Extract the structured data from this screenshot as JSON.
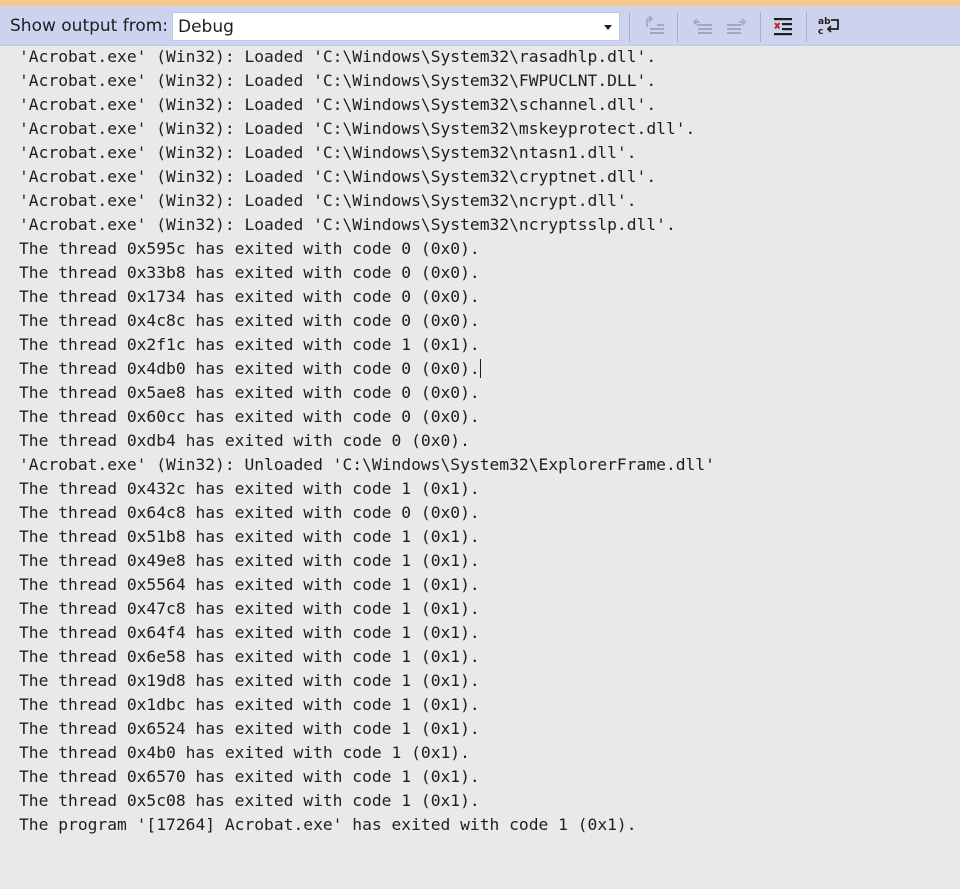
{
  "toolbar": {
    "show_output_label": "Show output from:",
    "source_select": {
      "selected": "Debug"
    },
    "buttons": [
      {
        "name": "find-message-in-code-button",
        "icon": "find-in-code-icon",
        "enabled": false
      },
      {
        "name": "previous-message-button",
        "icon": "go-to-previous-icon",
        "enabled": false
      },
      {
        "name": "next-message-button",
        "icon": "go-to-next-icon",
        "enabled": false
      },
      {
        "name": "clear-all-button",
        "icon": "clear-all-icon",
        "enabled": true
      },
      {
        "name": "toggle-word-wrap-button",
        "icon": "word-wrap-icon",
        "enabled": true
      }
    ]
  },
  "output": {
    "lines": [
      "'Acrobat.exe' (Win32): Loaded 'C:\\Windows\\System32\\rasadhlp.dll'.",
      "'Acrobat.exe' (Win32): Loaded 'C:\\Windows\\System32\\FWPUCLNT.DLL'.",
      "'Acrobat.exe' (Win32): Loaded 'C:\\Windows\\System32\\schannel.dll'.",
      "'Acrobat.exe' (Win32): Loaded 'C:\\Windows\\System32\\mskeyprotect.dll'.",
      "'Acrobat.exe' (Win32): Loaded 'C:\\Windows\\System32\\ntasn1.dll'.",
      "'Acrobat.exe' (Win32): Loaded 'C:\\Windows\\System32\\cryptnet.dll'.",
      "'Acrobat.exe' (Win32): Loaded 'C:\\Windows\\System32\\ncrypt.dll'.",
      "'Acrobat.exe' (Win32): Loaded 'C:\\Windows\\System32\\ncryptsslp.dll'.",
      "The thread 0x595c has exited with code 0 (0x0).",
      "The thread 0x33b8 has exited with code 0 (0x0).",
      "The thread 0x1734 has exited with code 0 (0x0).",
      "The thread 0x4c8c has exited with code 0 (0x0).",
      "The thread 0x2f1c has exited with code 1 (0x1).",
      "The thread 0x4db0 has exited with code 0 (0x0).",
      "The thread 0x5ae8 has exited with code 0 (0x0).",
      "The thread 0x60cc has exited with code 0 (0x0).",
      "The thread 0xdb4 has exited with code 0 (0x0).",
      "'Acrobat.exe' (Win32): Unloaded 'C:\\Windows\\System32\\ExplorerFrame.dll'",
      "The thread 0x432c has exited with code 1 (0x1).",
      "The thread 0x64c8 has exited with code 0 (0x0).",
      "The thread 0x51b8 has exited with code 1 (0x1).",
      "The thread 0x49e8 has exited with code 1 (0x1).",
      "The thread 0x5564 has exited with code 1 (0x1).",
      "The thread 0x47c8 has exited with code 1 (0x1).",
      "The thread 0x64f4 has exited with code 1 (0x1).",
      "The thread 0x6e58 has exited with code 1 (0x1).",
      "The thread 0x19d8 has exited with code 1 (0x1).",
      "The thread 0x1dbc has exited with code 1 (0x1).",
      "The thread 0x6524 has exited with code 1 (0x1).",
      "The thread 0x4b0 has exited with code 1 (0x1).",
      "The thread 0x6570 has exited with code 1 (0x1).",
      "The thread 0x5c08 has exited with code 1 (0x1).",
      "The program '[17264] Acrobat.exe' has exited with code 1 (0x1)."
    ],
    "caret_line": 13
  },
  "colors": {
    "toolbar_bg": "#cdd3ee",
    "accent": "#f5c88e",
    "output_bg": "#e9e9eb",
    "text": "#1e1e1e"
  }
}
